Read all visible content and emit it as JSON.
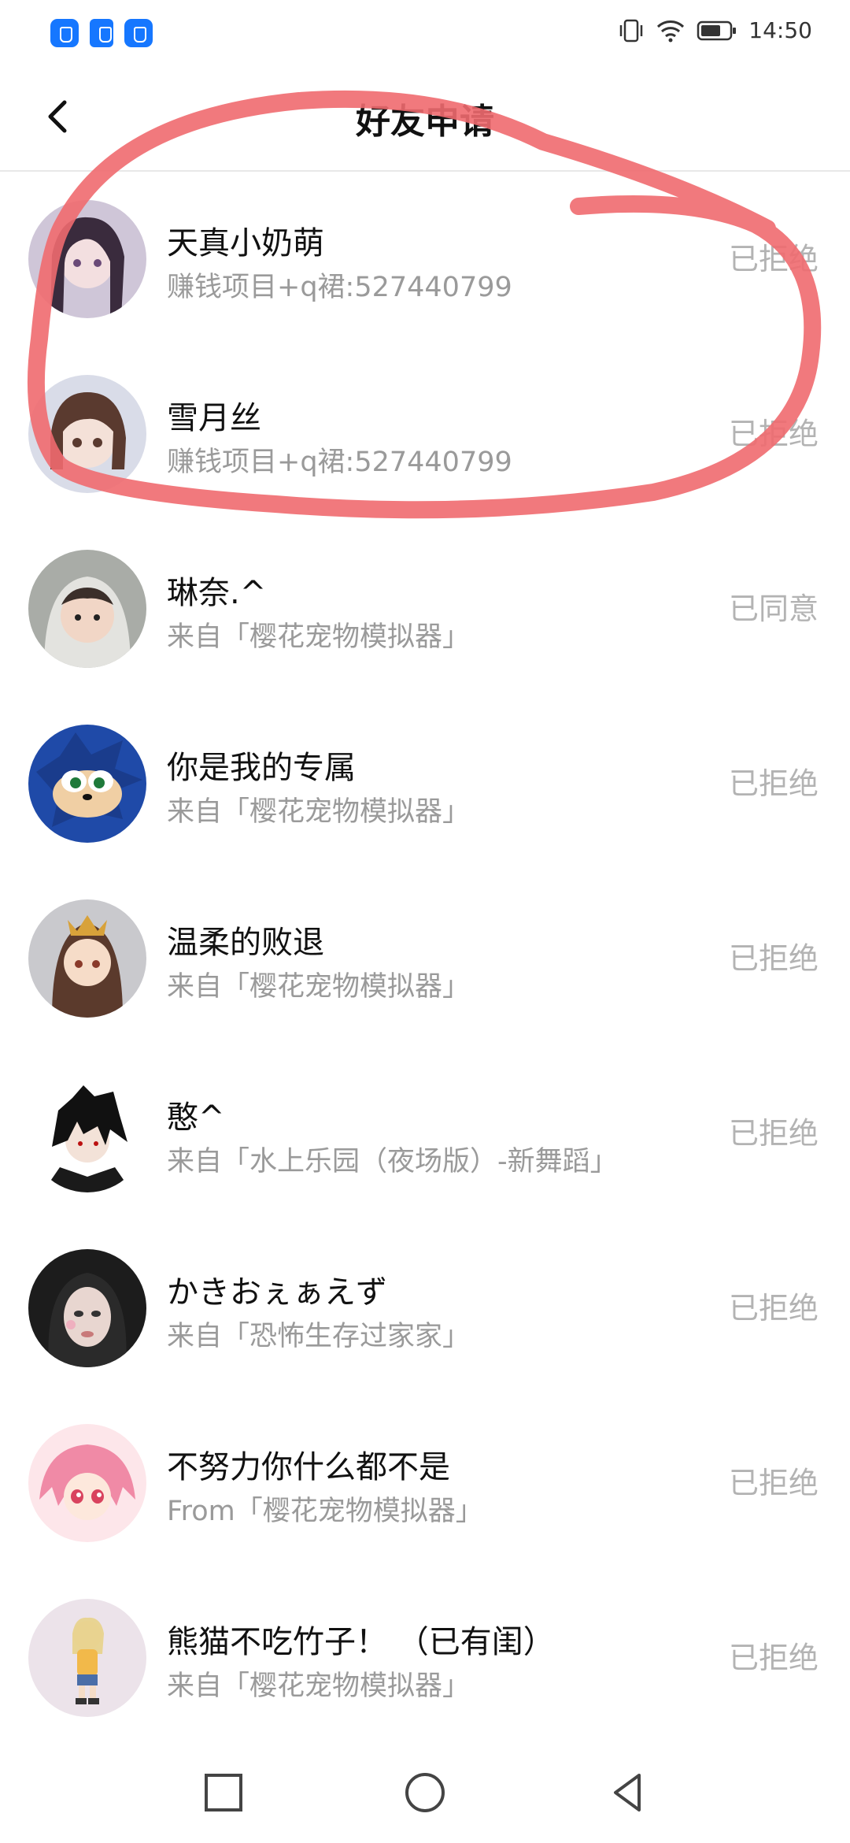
{
  "status_bar": {
    "time": "14:50"
  },
  "header": {
    "title": "好友申请"
  },
  "requests": [
    {
      "name": "天真小奶萌",
      "subtitle": "赚钱项目+q裙:527440799",
      "status": "已拒绝",
      "avatar": "anime-girl-avatar"
    },
    {
      "name": "雪月丝",
      "subtitle": "赚钱项目+q裙:527440799",
      "status": "已拒绝",
      "avatar": "anime-girl-avatar"
    },
    {
      "name": "琳奈.^",
      "subtitle": "来自「樱花宠物模拟器」",
      "status": "已同意",
      "avatar": "baby-photo-avatar"
    },
    {
      "name": "你是我的专属",
      "subtitle": "来自「樱花宠物模拟器」",
      "status": "已拒绝",
      "avatar": "sonic-avatar"
    },
    {
      "name": "温柔的败退",
      "subtitle": "来自「樱花宠物模拟器」",
      "status": "已拒绝",
      "avatar": "anime-girl-avatar"
    },
    {
      "name": "憨^",
      "subtitle": "来自「水上乐园（夜场版）-新舞蹈」",
      "status": "已拒绝",
      "avatar": "anime-boy-avatar"
    },
    {
      "name": "かきおぇぁえず",
      "subtitle": "来自「恐怖生存过家家」",
      "status": "已拒绝",
      "avatar": "girl-photo-avatar"
    },
    {
      "name": "不努力你什么都不是",
      "subtitle": "From「樱花宠物模拟器」",
      "status": "已拒绝",
      "avatar": "pink-anime-avatar"
    },
    {
      "name": "熊猫不吃竹子！ （已有闺）",
      "subtitle": "来自「樱花宠物模拟器」",
      "status": "已拒绝",
      "avatar": "chibi-avatar"
    }
  ],
  "colors": {
    "accent": "#1677ff",
    "scribble": "#f06a6f",
    "muted_text": "#9a9a9a",
    "status_text": "#b3b3b3"
  }
}
